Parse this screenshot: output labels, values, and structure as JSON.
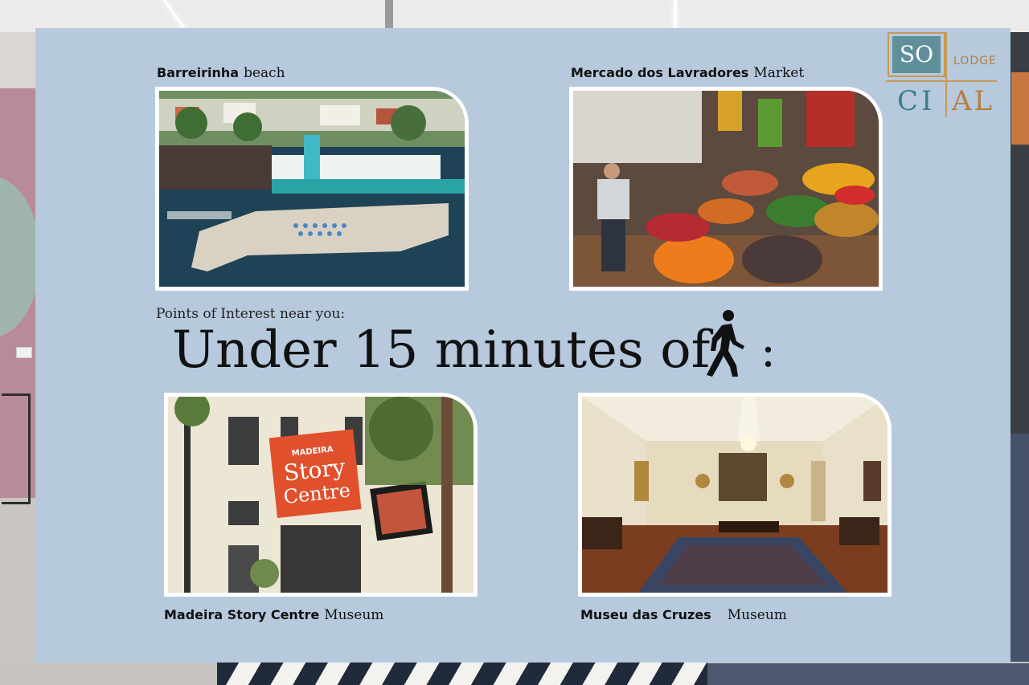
{
  "poster": {
    "poi_label": "Points of Interest near you:",
    "headline": "Under 15 minutes of",
    "headline_suffix": ":",
    "walk_icon": "walking-person-icon"
  },
  "logo": {
    "so": "SO",
    "lodge": "LODGE",
    "ci": "CI",
    "al": "AL",
    "colors": {
      "teal": "#5f8f9b",
      "gold": "#c79a55"
    }
  },
  "places": [
    {
      "name": "Barreirinha",
      "type": "beach"
    },
    {
      "name": "Mercado dos Lavradores",
      "type": "Market"
    },
    {
      "name": "Madeira Story Centre",
      "type": "Museum"
    },
    {
      "name": "Museu das Cruzes",
      "type": "Museum"
    }
  ],
  "photo_text": {
    "story_madeira": "MADEIRA",
    "story_title_1": "Story",
    "story_title_2": "Centre"
  },
  "colors": {
    "poster_bg": "#b6c9dd",
    "text": "#111111"
  }
}
